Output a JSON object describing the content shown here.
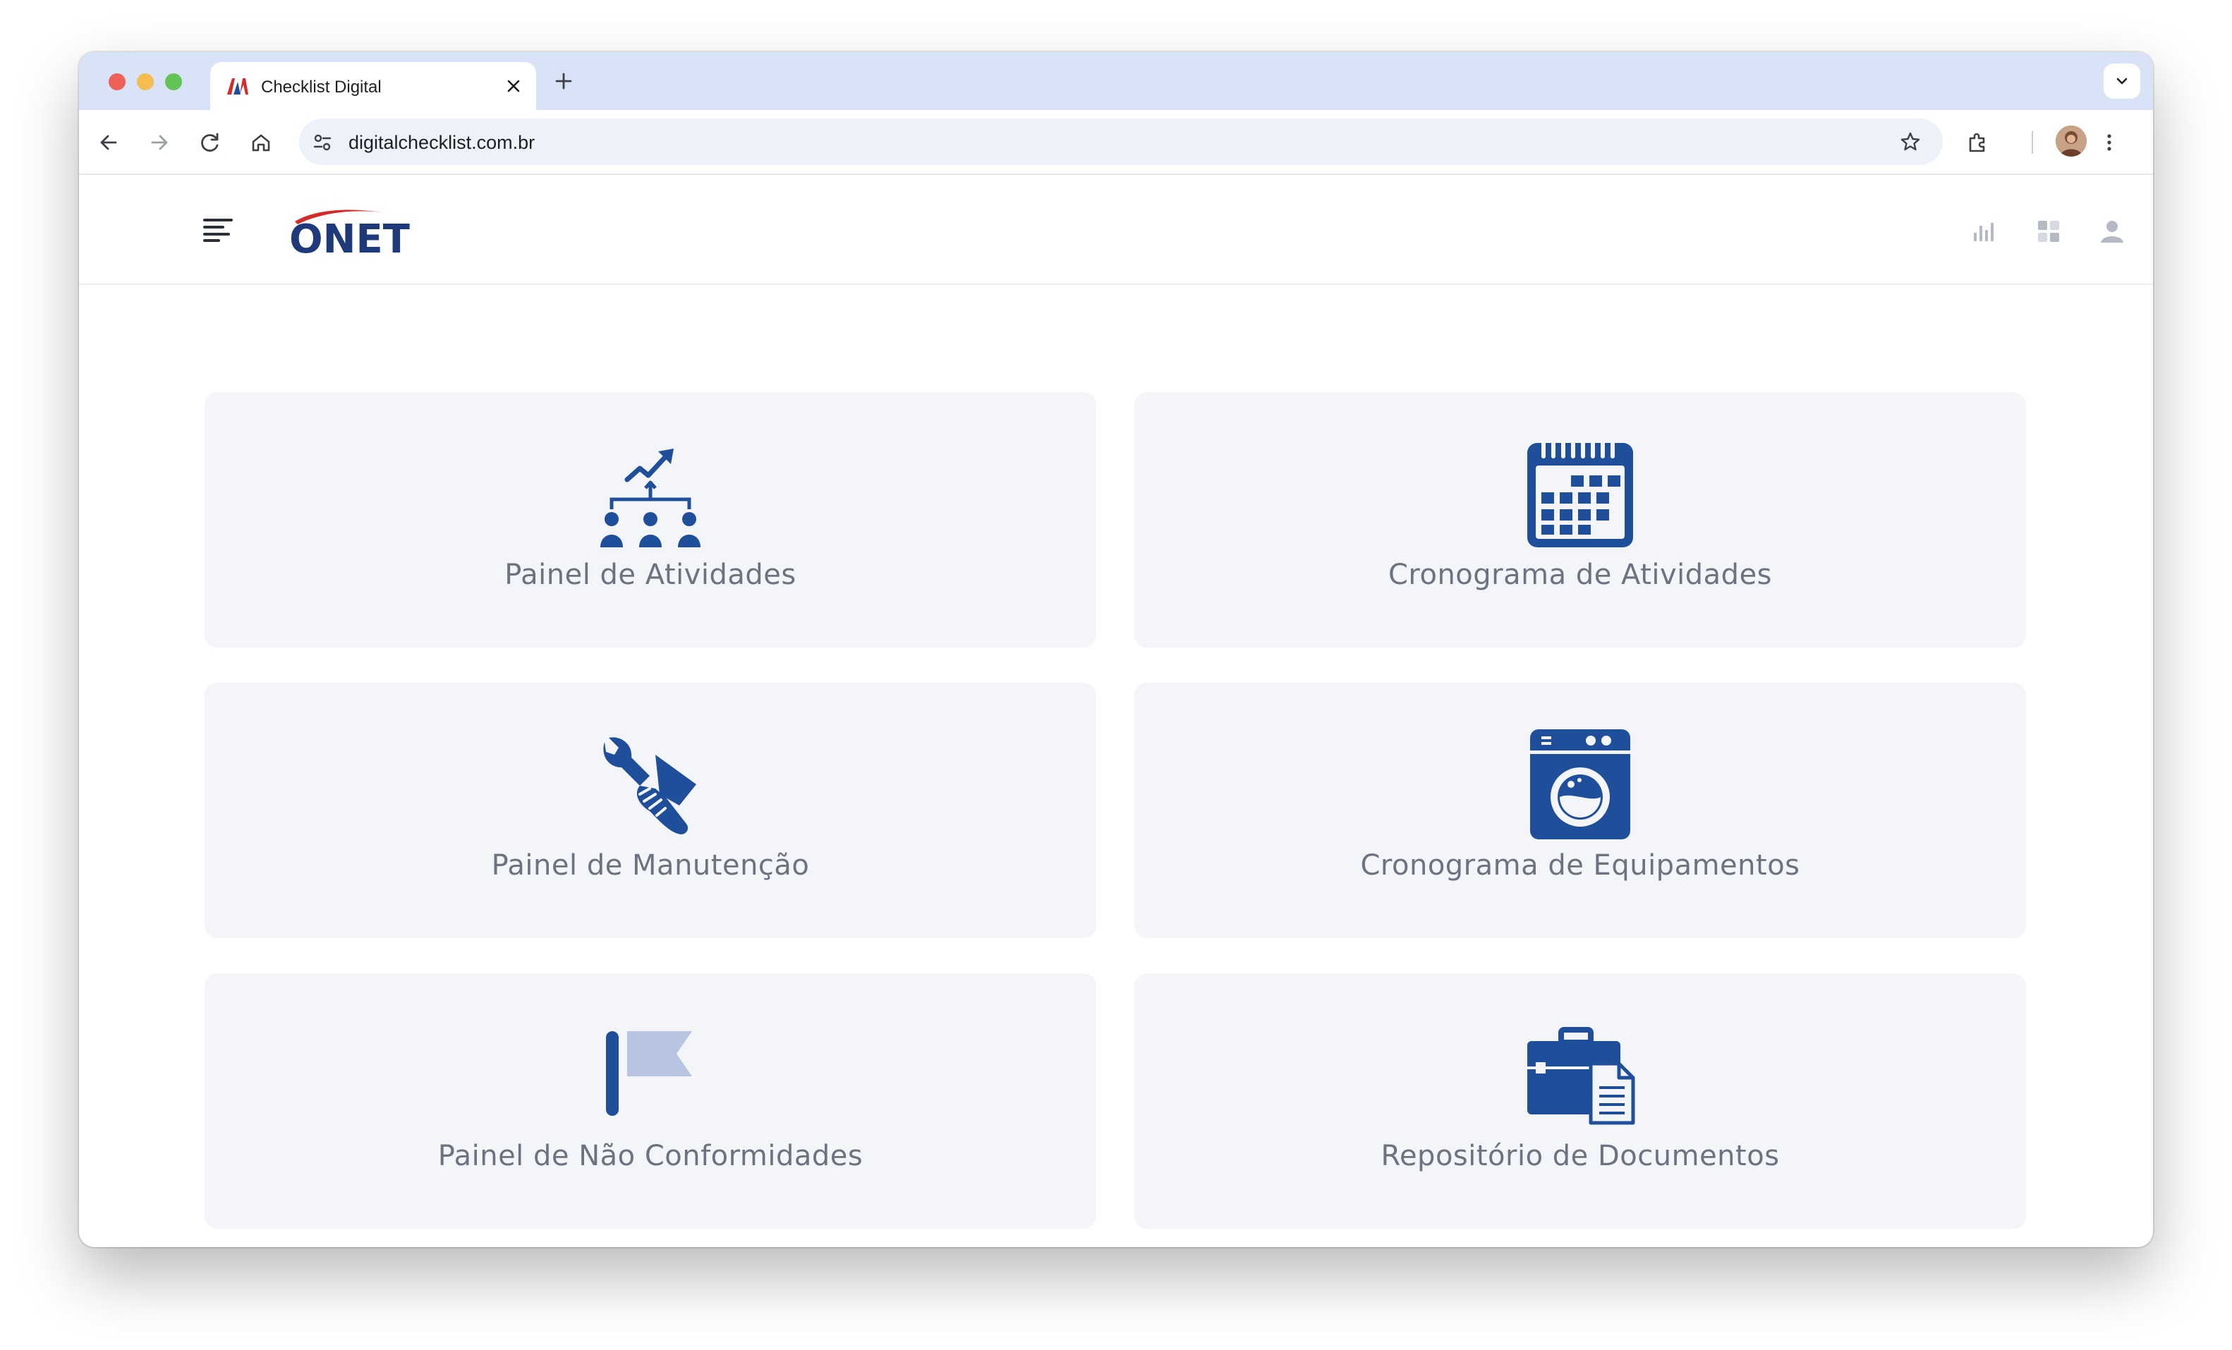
{
  "browser": {
    "tab_title": "Checklist Digital",
    "url": "digitalchecklist.com.br"
  },
  "app": {
    "logo_text": "ONET"
  },
  "cards": [
    {
      "label": "Painel de Atividades",
      "icon": "team-growth-icon"
    },
    {
      "label": "Cronograma de Atividades",
      "icon": "calendar-icon"
    },
    {
      "label": "Painel de Manutenção",
      "icon": "wrench-hand-icon"
    },
    {
      "label": "Cronograma de Equipamentos",
      "icon": "washing-machine-icon"
    },
    {
      "label": "Painel de Não Conformidades",
      "icon": "flag-icon"
    },
    {
      "label": "Repositório de Documentos",
      "icon": "briefcase-document-icon"
    }
  ],
  "colors": {
    "accent": "#1f4e9b",
    "card_bg": "#f3f5f9",
    "label": "#6d7180",
    "flag_light": "#b7c5e0",
    "logo_red": "#d42a2a"
  }
}
